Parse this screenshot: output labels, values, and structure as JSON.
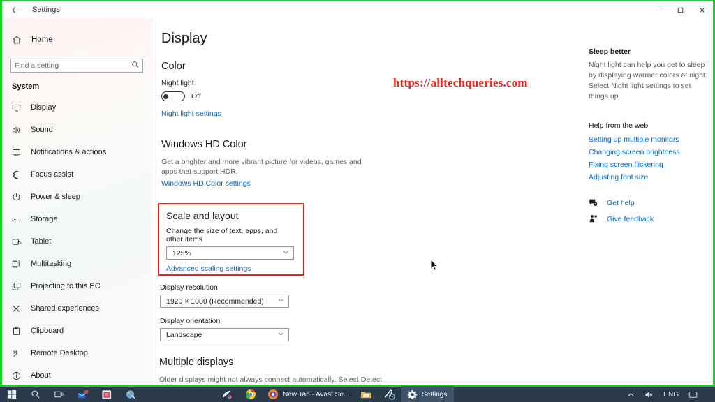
{
  "window": {
    "title": "Settings",
    "back_icon": "back-arrow-icon",
    "minimize_label": "Minimize",
    "maximize_label": "Maximize",
    "close_label": "Close"
  },
  "sidebar": {
    "home_label": "Home",
    "home_icon": "home-icon",
    "search": {
      "placeholder": "Find a setting",
      "value": "",
      "icon": "search-icon"
    },
    "group_header": "System",
    "items": [
      {
        "label": "Display",
        "icon": "monitor-icon",
        "active": true
      },
      {
        "label": "Sound",
        "icon": "speaker-icon",
        "active": false
      },
      {
        "label": "Notifications & actions",
        "icon": "notification-icon",
        "active": false
      },
      {
        "label": "Focus assist",
        "icon": "moon-icon",
        "active": false
      },
      {
        "label": "Power & sleep",
        "icon": "power-icon",
        "active": false
      },
      {
        "label": "Storage",
        "icon": "drive-icon",
        "active": false
      },
      {
        "label": "Tablet",
        "icon": "tablet-icon",
        "active": false
      },
      {
        "label": "Multitasking",
        "icon": "multitasking-icon",
        "active": false
      },
      {
        "label": "Projecting to this PC",
        "icon": "projecting-icon",
        "active": false
      },
      {
        "label": "Shared experiences",
        "icon": "share-icon",
        "active": false
      },
      {
        "label": "Clipboard",
        "icon": "clipboard-icon",
        "active": false
      },
      {
        "label": "Remote Desktop",
        "icon": "remote-desktop-icon",
        "active": false
      },
      {
        "label": "About",
        "icon": "info-icon",
        "active": false
      }
    ]
  },
  "main": {
    "page_title": "Display",
    "color": {
      "heading": "Color",
      "night_light_label": "Night light",
      "night_light_state": "Off",
      "night_light_settings_link": "Night light settings"
    },
    "hd_color": {
      "heading": "Windows HD Color",
      "description": "Get a brighter and more vibrant picture for videos, games and apps that support HDR.",
      "settings_link": "Windows HD Color settings"
    },
    "scale_layout": {
      "heading": "Scale and layout",
      "scale_label": "Change the size of text, apps, and other items",
      "scale_value": "125%",
      "advanced_link": "Advanced scaling settings",
      "highlight_color": "#e8251f"
    },
    "resolution": {
      "label": "Display resolution",
      "value": "1920 × 1080 (Recommended)"
    },
    "orientation": {
      "label": "Display orientation",
      "value": "Landscape"
    },
    "multiple_displays": {
      "heading": "Multiple displays",
      "description": "Older displays might not always connect automatically. Select Detect to"
    }
  },
  "right_panel": {
    "tip_heading": "Sleep better",
    "tip_text": "Night light can help you get to sleep by displaying warmer colors at night. Select Night light settings to set things up.",
    "help_heading": "Help from the web",
    "help_links": [
      "Setting up multiple monitors",
      "Changing screen brightness",
      "Fixing screen flickering",
      "Adjusting font size"
    ],
    "get_help_label": "Get help",
    "get_help_icon": "get-help-icon",
    "give_feedback_label": "Give feedback",
    "give_feedback_icon": "feedback-icon"
  },
  "watermark": {
    "text": "https://alltechqueries.com",
    "color": "#e8251f"
  },
  "taskbar": {
    "start_icon": "windows-start-icon",
    "search_icon": "search-icon",
    "taskview_icon": "task-view-icon",
    "pinned": [
      {
        "icon": "mail-icon",
        "label": "Mail"
      },
      {
        "icon": "sticky-notes-icon",
        "label": "Sticky Notes"
      },
      {
        "icon": "paint-icon",
        "label": "Paint"
      }
    ],
    "running": [
      {
        "icon": "avast-icon",
        "label": ""
      },
      {
        "icon": "chrome-icon",
        "label": ""
      },
      {
        "icon": "avast-browser-icon",
        "label": "New Tab - Avast Se..."
      },
      {
        "icon": "file-explorer-icon",
        "label": ""
      },
      {
        "icon": "driver-updater-icon",
        "label": ""
      },
      {
        "icon": "settings-icon",
        "label": "Settings"
      }
    ],
    "tray": {
      "chevron_icon": "chevron-up-icon",
      "volume_icon": "volume-icon",
      "language": "ENG",
      "show_desktop_icon": "show-desktop-icon"
    },
    "accent_color": "#1ecb2c"
  }
}
